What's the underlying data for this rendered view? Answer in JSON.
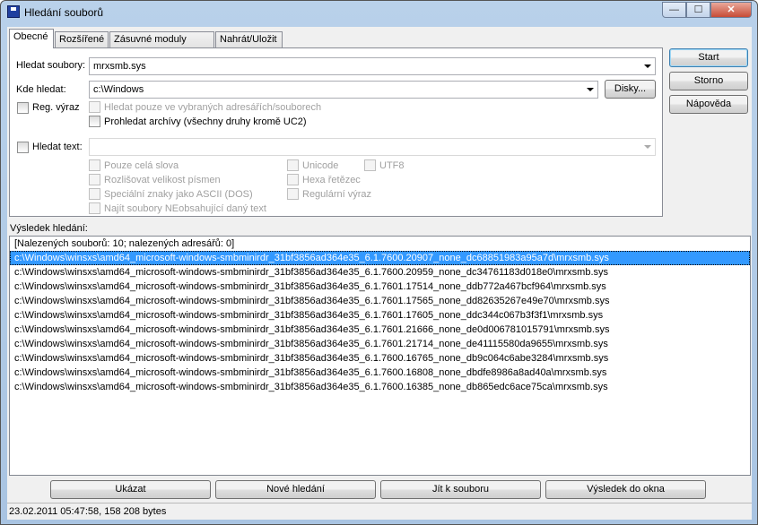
{
  "window": {
    "title": "Hledání souborů",
    "min": "—",
    "max": "☐",
    "close": "✕"
  },
  "tabs": [
    "Obecné",
    "Rozšířené",
    "Zásuvné moduly",
    "Nahrát/Uložit"
  ],
  "form": {
    "search_files_label": "Hledat soubory:",
    "search_files_value": "mrxsmb.sys",
    "search_in_label": "Kde hledat:",
    "search_in_value": "c:\\Windows",
    "drives_button": "Disky...",
    "regex_label": "Reg. výraz",
    "only_selected_label": "Hledat pouze ve vybraných adresářích/souborech",
    "search_archives_label": "Prohledat archívy (všechny druhy kromě UC2)",
    "search_text_label": "Hledat text:",
    "search_text_value": "",
    "whole_words": "Pouze celá slova",
    "case_sensitive": "Rozlišovat velikost písmen",
    "ascii_dos": "Speciální znaky jako ASCII (DOS)",
    "not_containing": "Najít soubory NEobsahující daný text",
    "unicode": "Unicode",
    "utf8": "UTF8",
    "hex": "Hexa řetězec",
    "regex_text": "Regulární výraz"
  },
  "side_buttons": {
    "start": "Start",
    "cancel": "Storno",
    "help": "Nápověda"
  },
  "results": {
    "label": "Výsledek hledání:",
    "summary": "[Nalezených souborů: 10; nalezených adresářů: 0]",
    "selected_index": 0,
    "items": [
      "c:\\Windows\\winsxs\\amd64_microsoft-windows-smbminirdr_31bf3856ad364e35_6.1.7600.20907_none_dc68851983a95a7d\\mrxsmb.sys",
      "c:\\Windows\\winsxs\\amd64_microsoft-windows-smbminirdr_31bf3856ad364e35_6.1.7600.20959_none_dc34761183d018e0\\mrxsmb.sys",
      "c:\\Windows\\winsxs\\amd64_microsoft-windows-smbminirdr_31bf3856ad364e35_6.1.7601.17514_none_ddb772a467bcf964\\mrxsmb.sys",
      "c:\\Windows\\winsxs\\amd64_microsoft-windows-smbminirdr_31bf3856ad364e35_6.1.7601.17565_none_dd82635267e49e70\\mrxsmb.sys",
      "c:\\Windows\\winsxs\\amd64_microsoft-windows-smbminirdr_31bf3856ad364e35_6.1.7601.17605_none_ddc344c067b3f3f1\\mrxsmb.sys",
      "c:\\Windows\\winsxs\\amd64_microsoft-windows-smbminirdr_31bf3856ad364e35_6.1.7601.21666_none_de0d006781015791\\mrxsmb.sys",
      "c:\\Windows\\winsxs\\amd64_microsoft-windows-smbminirdr_31bf3856ad364e35_6.1.7601.21714_none_de41115580da9655\\mrxsmb.sys",
      "c:\\Windows\\winsxs\\amd64_microsoft-windows-smbminirdr_31bf3856ad364e35_6.1.7600.16765_none_db9c064c6abe3284\\mrxsmb.sys",
      "c:\\Windows\\winsxs\\amd64_microsoft-windows-smbminirdr_31bf3856ad364e35_6.1.7600.16808_none_dbdfe8986a8ad40a\\mrxsmb.sys",
      "c:\\Windows\\winsxs\\amd64_microsoft-windows-smbminirdr_31bf3856ad364e35_6.1.7600.16385_none_db865edc6ace75ca\\mrxsmb.sys"
    ]
  },
  "bottom_buttons": {
    "show": "Ukázat",
    "new_search": "Nové hledání",
    "goto_file": "Jít k souboru",
    "to_panel": "Výsledek do okna"
  },
  "status": "23.02.2011 05:47:58, 158 208 bytes"
}
